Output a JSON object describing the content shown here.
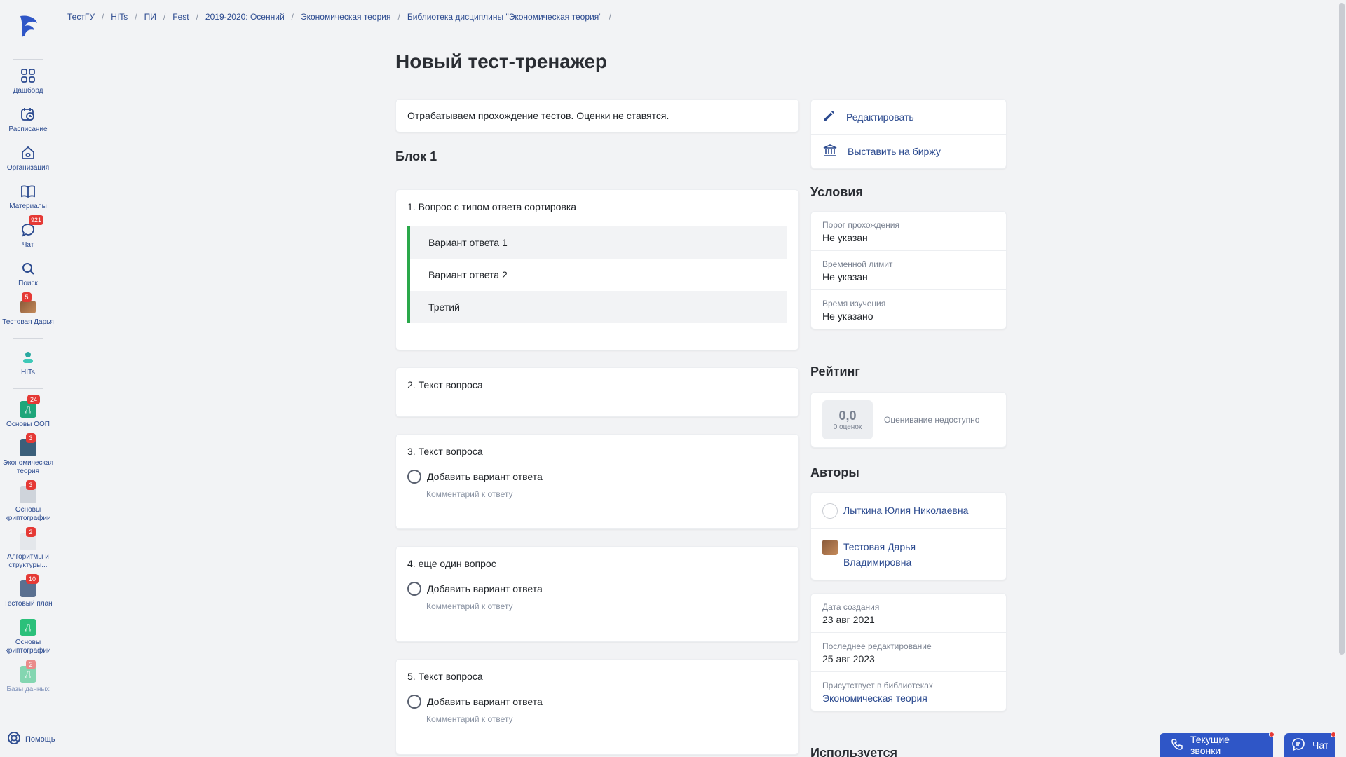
{
  "sidebar": {
    "items": [
      {
        "label": "Дашборд",
        "icon": "grid-icon"
      },
      {
        "label": "Расписание",
        "icon": "calendar-clock-icon"
      },
      {
        "label": "Организация",
        "icon": "home-icon"
      },
      {
        "label": "Материалы",
        "icon": "book-icon"
      },
      {
        "label": "Чат",
        "icon": "chat-icon",
        "badge": "921"
      },
      {
        "label": "Поиск",
        "icon": "search-icon"
      },
      {
        "label": "Тестовая Дарья",
        "icon": "user-avatar",
        "badge": "5"
      }
    ],
    "org": {
      "label": "HITs"
    },
    "courses": [
      {
        "label": "Основы ООП",
        "badge": "24",
        "letter": "Д",
        "color": "#1ea67a"
      },
      {
        "label": "Экономическая теория",
        "badge": "3",
        "letter": "",
        "color": "#3b5f7a"
      },
      {
        "label": "Основы криптографии",
        "badge": "3",
        "letter": "",
        "color": "#cfd4db"
      },
      {
        "label": "Алгоритмы и структуры...",
        "badge": "2",
        "letter": "",
        "color": "#cfd4db"
      },
      {
        "label": "Тестовый план",
        "badge": "10",
        "letter": "",
        "color": "#5a7090"
      },
      {
        "label": "Основы криптографии",
        "badge": "",
        "letter": "Д",
        "color": "#2bc07a"
      },
      {
        "label": "Базы данных кратко",
        "badge": "2",
        "letter": "Д",
        "color": "#2bc07a"
      }
    ],
    "help": "Помощь"
  },
  "breadcrumb": [
    "ТестГУ",
    "HITs",
    "ПИ",
    "Fest",
    "2019-2020: Осенний",
    "Экономическая теория",
    "Библиотека дисциплины \"Экономическая теория\""
  ],
  "page": {
    "title": "Новый тест-тренажер",
    "description": "Отрабатываем прохождение тестов. Оценки не ставятся.",
    "block_title": "Блок 1"
  },
  "questions": [
    {
      "title": "1. Вопрос с типом ответа сортировка",
      "sort_options": [
        "Вариант ответа 1",
        "Вариант ответа 2",
        "Третий"
      ]
    },
    {
      "title": "2. Текст вопроса"
    },
    {
      "title": "3. Текст вопроса",
      "answer": "Добавить вариант ответа",
      "comment": "Комментарий к ответу"
    },
    {
      "title": "4. еще один вопрос",
      "answer": "Добавить вариант ответа",
      "comment": "Комментарий к ответу"
    },
    {
      "title": "5. Текст вопроса",
      "answer": "Добавить вариант ответа",
      "comment": "Комментарий к ответу"
    }
  ],
  "actions": {
    "edit": "Редактировать",
    "exchange": "Выставить на биржу"
  },
  "conditions": {
    "heading": "Условия",
    "items": [
      {
        "label": "Порог прохождения",
        "value": "Не указан"
      },
      {
        "label": "Временной лимит",
        "value": "Не указан"
      },
      {
        "label": "Время изучения",
        "value": "Не указано"
      }
    ]
  },
  "rating": {
    "heading": "Рейтинг",
    "value": "0,0",
    "count": "0 оценок",
    "status": "Оценивание недоступно"
  },
  "authors": {
    "heading": "Авторы",
    "names": [
      "Лыткина Юлия Николаевна",
      "Тестовая Дарья Владимировна"
    ]
  },
  "meta": {
    "created_label": "Дата создания",
    "created": "23 авг 2021",
    "edited_label": "Последнее редактирование",
    "edited": "25 авг 2023",
    "library_label": "Присутствует в библиотеках",
    "library": "Экономическая теория"
  },
  "used_heading": "Используется",
  "floating": {
    "calls": "Текущие звонки",
    "chat": "Чат"
  },
  "colors": {
    "accent": "#2f56c7",
    "link": "#2b4a8f",
    "sort_bar": "#2aa84a",
    "badge": "#e53935"
  }
}
